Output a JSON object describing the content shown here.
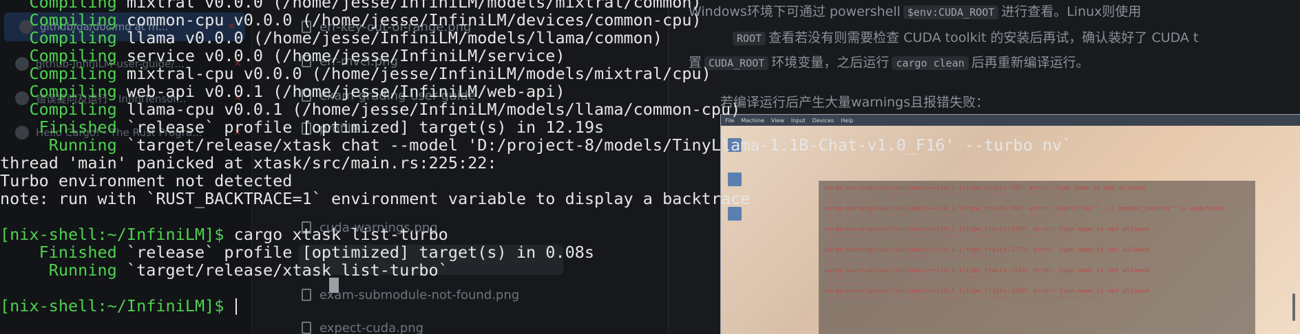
{
  "terminal": {
    "lines": [
      {
        "kind": "compile",
        "keyword": "Compiling",
        "text": " mixtral v0.0.0 (/home/jesse/InfiniLM/models/mixtral/common)"
      },
      {
        "kind": "compile",
        "keyword": "Compiling",
        "text": " common-cpu v0.0.0 (/home/jesse/InfiniLM/devices/common-cpu)"
      },
      {
        "kind": "compile",
        "keyword": "Compiling",
        "text": " llama v0.0.0 (/home/jesse/InfiniLM/models/llama/common)"
      },
      {
        "kind": "compile",
        "keyword": "Compiling",
        "text": " service v0.0.0 (/home/jesse/InfiniLM/service)"
      },
      {
        "kind": "compile",
        "keyword": "Compiling",
        "text": " mixtral-cpu v0.0.0 (/home/jesse/InfiniLM/models/mixtral/cpu)"
      },
      {
        "kind": "compile",
        "keyword": "Compiling",
        "text": " web-api v0.0.1 (/home/jesse/InfiniLM/web-api)"
      },
      {
        "kind": "compile",
        "keyword": "Compiling",
        "text": " llama-cpu v0.0.1 (/home/jesse/InfiniLM/models/llama/common-cpu)"
      },
      {
        "kind": "compile",
        "keyword": " Finished",
        "text": " `release` profile [optimized] target(s) in 12.19s"
      },
      {
        "kind": "compile",
        "keyword": "  Running",
        "text": " `target/release/xtask chat --model 'D:/project-8/models/TinyLlama-1.1B-Chat-v1.0_F16' --turbo nv`"
      },
      {
        "kind": "plain",
        "text": "thread 'main' panicked at xtask/src/main.rs:225:22:"
      },
      {
        "kind": "plain",
        "text": "Turbo environment not detected"
      },
      {
        "kind": "plain",
        "text": "note: run with `RUST_BACKTRACE=1` environment variable to display a backtrace"
      },
      {
        "kind": "blank",
        "text": ""
      },
      {
        "kind": "prompt",
        "prompt": "[nix-shell:~/InfiniLM]$",
        "text": " cargo xtask list-turbo"
      },
      {
        "kind": "compile",
        "keyword": " Finished",
        "text": " `release` profile [optimized] target(s) in 0.08s"
      },
      {
        "kind": "compile",
        "keyword": "  Running",
        "text": " `target/release/xtask list-turbo`"
      },
      {
        "kind": "blank",
        "text": ""
      },
      {
        "kind": "prompt",
        "prompt": "[nix-shell:~/InfiniLM]$",
        "text": " "
      }
    ]
  },
  "background_tabs": [
    {
      "label": "github/qa/doc.md at m...",
      "active": true
    },
    {
      "label": "github-InfiniLM-user-guide/...",
      "active": false
    },
    {
      "label": "错误提问及运行 - InfiniTensor...",
      "active": false
    },
    {
      "label": "Hello Cargo! - The Rust Progra...",
      "active": false
    }
  ],
  "background_files": [
    {
      "name": "err-key-out-of-range.png"
    },
    {
      "name": "err-mvcl.png"
    },
    {
      "name": "exam-grading-user-guide"
    },
    {
      "name": "profile"
    },
    {
      "name": "cuda-warnings.png"
    },
    {
      "name": "exam-submodule-not-found.png"
    },
    {
      "name": "expect-cuda.png"
    }
  ],
  "doc": {
    "line1_text": "Windows环境下可通过 powershell",
    "line1_code": "$env:CUDA_ROOT",
    "line1_tail": "进行查看。Linux则使用",
    "line2_code": "ROOT",
    "line2_text": "查看若没有则需要检查 CUDA toolkit 的安装后再试，确认装好了 CUDA t",
    "line3_head": "置",
    "line3_code1": "CUDA_ROOT",
    "line3_mid": "环境变量，之后运行",
    "line3_code2": "cargo clean",
    "line3_tail": "后再重新编译运行。",
    "line4_text": "若编译运行后产生大量warnings且报错失败："
  },
  "screenshot": {
    "menu": [
      "File",
      "Machine",
      "View",
      "Input",
      "Devices",
      "Help"
    ],
    "warning_lines": [
      "cargo:warning=/usr/include/c++/14.1.1/type_traits:709:  error: type name is not allowed",
      "cargo:warning=      : public __bool_constant<__is_member_pointer(_Tp)>",
      "cargo:warning=",
      "cargo:warning=/usr/include/c++/14.1.1/type_traits:760: error: identifier \"__is_member_pointer\" is undefined",
      "cargo:warning=      : public __bool_constant<__is_member_pointer(_Tp)>",
      "cargo:warning=",
      "cargo:warning=/usr/include/c++/14.1.1/type_traits:1487: error: type name is not allowed",
      "cargo:warning=    inline constexpr bool is_array_v = __is_array(_Tp);",
      "cargo:warning=",
      "cargo:warning=/usr/include/c++/14.1.1/type_traits:3271: error: type name is not allowed",
      "cargo:warning=      = __is_member_object_pointer(_Tp);",
      "cargo:warning=",
      "cargo:warning=/usr/include/c++/14.1.1/type_traits:3281: error: type name is not allowed",
      "cargo:warning=      = __is_member_function_pointer(_Tp);",
      "cargo:warning=",
      "cargo:warning=/usr/include/c++/14.1.1/type_traits:3298: error: type name is not allowed",
      "cargo:warning=    inline constexpr bool is_reference_v = __is_reference(_Tp);"
    ]
  }
}
